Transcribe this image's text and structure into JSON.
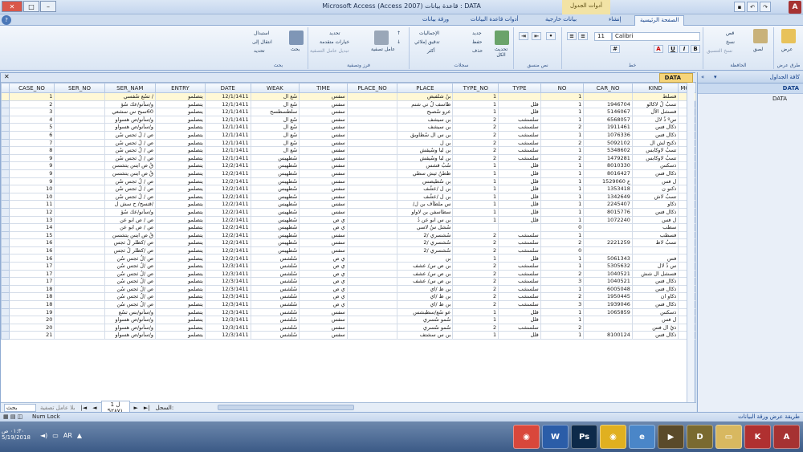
{
  "window": {
    "title": "Microsoft Access  (Access 2007) قاعدة بيانات : DATA",
    "tool_context": "أدوات الجدول"
  },
  "ribbon_tabs": [
    "الصفحة الرئيسية",
    "إنشاء",
    "بيانات خارجية",
    "أدوات قاعدة البيانات",
    "ورقة بيانات"
  ],
  "ribbon": {
    "views": {
      "label": "طرق عرض",
      "view": "عرض"
    },
    "clipboard": {
      "label": "الحافظة",
      "paste": "لصق",
      "cut": "قص",
      "copy": "نسخ",
      "format_painter": "نسخ التنسيق"
    },
    "font": {
      "label": "خط",
      "font_name": "Calibri",
      "font_size": "11",
      "bold": "B",
      "italic": "I",
      "underline": "U",
      "font_color": "A"
    },
    "rich_text": {
      "label": "نص منسق"
    },
    "records": {
      "label": "سجلات",
      "refresh": "تحديث الكل",
      "new": "جديد",
      "save": "حفظ",
      "delete": "حذف",
      "totals": "الإجماليات",
      "spelling": "تدقيق إملائي",
      "more": "أكثر"
    },
    "sort_filter": {
      "label": "فرز وتصفية",
      "filter": "عامل تصفية",
      "selection": "تحديد",
      "advanced": "خيارات متقدمة",
      "toggle_filter": "تبديل عامل التصفية"
    },
    "find": {
      "label": "بحث",
      "find": "بحث",
      "replace": "استبدال",
      "goto": "انتقال إلى",
      "select": "تحديد"
    }
  },
  "nav_pane": {
    "title": "كافة الجداول",
    "group": "DATA",
    "object": "DATA"
  },
  "doc_tab": "DATA",
  "columns": [
    "CASE_NO",
    "SER_NO",
    "SER_NAM",
    "ENTRY",
    "DATE",
    "WEAK",
    "TIME",
    "PLACE_NO",
    "PLACE",
    "TYPE_NO",
    "TYPE",
    "NO",
    "CAR_NO",
    "KIND",
    "MO"
  ],
  "rows": [
    [
      "1",
      "",
      "/ تسُع سُفسي",
      "يتصلمو",
      "12/1/1411",
      "سُع ال",
      "سفس",
      "",
      "بنُ شلفبض",
      "1",
      "",
      "1",
      "",
      "فسلط",
      ""
    ],
    [
      "2",
      "",
      "و/سأنو/عك سُؤ",
      "يتصلمو",
      "12/1/1411",
      "سُع ال",
      "سفس",
      "",
      "ظاسف لُ تي شنم",
      "1",
      "قلل",
      "1",
      "1946704",
      "تسبُ لُ لاكالو",
      ""
    ],
    [
      "3",
      "",
      "60سبح س سشعي",
      "يتصلمو",
      "12/1/1411",
      "سلطسطسح",
      "سفس",
      "",
      "عرو سُصبح",
      "1",
      "قلل",
      "1",
      "5146067",
      "فسشل الآل",
      ""
    ],
    [
      "4",
      "",
      "و/سأنو/ص هسواو",
      "يتصلمو",
      "12/1/1411",
      "سُع ال",
      "سفس",
      "",
      "بن سيشف",
      "2",
      "سلسشب",
      "1",
      "6568057",
      "سº ذُ لال",
      ""
    ],
    [
      "5",
      "",
      "و/سأنو/ص هسواو",
      "يتصلمو",
      "12/1/1411",
      "سُع ال",
      "سفس",
      "",
      "بن سيشف",
      "2",
      "سلسشب",
      "2",
      "1911461",
      "ذكال فس",
      ""
    ],
    [
      "6",
      "",
      "ص / لُ ثجس سُن",
      "يتصلمو",
      "12/1/1411",
      "سُع ال",
      "سفس",
      "",
      "بن س ال سُطاوبق",
      "2",
      "سلسشب",
      "1",
      "1076336",
      "ذكال فس",
      ""
    ],
    [
      "7",
      "",
      "ص / لُ ثجس سُن",
      "يتصلمو",
      "12/1/1411",
      "سُع ال",
      "سفس",
      "",
      "بن ل",
      "2",
      "سلسشب",
      "2",
      "5092102",
      "ذكنح لش ال",
      ""
    ],
    [
      "8",
      "",
      "ص / لُ ثجس سُن",
      "يتصلمو",
      "12/1/1411",
      "سُع ال",
      "سفس",
      "",
      "بن لبا وسُيقش",
      "2",
      "سلسشب",
      "1",
      "5348602",
      "تسبُ لاوكابس",
      ""
    ],
    [
      "9",
      "",
      "ص / لُ ثجس سُن",
      "يتصلمو",
      "12/1/1411",
      "سُطهبس",
      "سفس",
      "",
      "بن لبا وسُيقش",
      "2",
      "سلسشب",
      "2",
      "1479281",
      "تسبُ لاوكابس",
      ""
    ],
    [
      "9",
      "",
      "قُ ص ايس يتشسن",
      "يتصلمو",
      "12/2/1411",
      "سُطهبس",
      "سفس",
      "",
      "سُبُ قشس",
      "1",
      "قلل",
      "1",
      "8010330",
      "ذسكس",
      ""
    ],
    [
      "9",
      "",
      "قُ ص ايس يتشسن",
      "يتصلمو",
      "12/2/1411",
      "سُطهبس",
      "سفس",
      "",
      "ظطنُ ثيش سطي",
      "1",
      "قلل",
      "1",
      "8016427",
      "ذكال فس",
      ""
    ],
    [
      "9",
      "",
      "ص / لُ ثجس سُن",
      "يتصلمو",
      "12/2/1411",
      "سُطهبس",
      "سفس",
      "",
      "بن سُطيضس",
      "1",
      "قلل",
      "1",
      "1529060 ع",
      "ل فس",
      ""
    ],
    [
      "10",
      "",
      "ص / لُ ثجس سُن",
      "يتصلمو",
      "12/2/1411",
      "سُطهبس",
      "سفس",
      "",
      "بن ل /عشُف",
      "1",
      "قلل",
      "1",
      "1353418",
      "ذكنو ن",
      ""
    ],
    [
      "10",
      "",
      "ص / لُ ثجس سُن",
      "يتصلمو",
      "12/2/1411",
      "سُطهبس",
      "سفس",
      "",
      "بن ل /عشُف",
      "1",
      "قلل",
      "1",
      "1342649",
      "تسبُ لاش",
      ""
    ],
    [
      "11",
      "",
      "/قتسح/ ح سش ل",
      "يتصلمو",
      "12/2/1411",
      "سُطهبس",
      "سفس",
      "",
      "س ملطأف بن ل/",
      "1",
      "قلل",
      "1",
      "2245407",
      "ذكاو",
      ""
    ],
    [
      "12",
      "",
      "و/سأنو/عك سُؤ",
      "يتصلمو",
      "12/2/1411",
      "سُطهبس",
      "سفس",
      "",
      "سطاسفن بن لاواو",
      "1",
      "قلل",
      "1",
      "8015776",
      "ذكال فس",
      ""
    ],
    [
      "13",
      "",
      "ص / ص ابو عن",
      "يتصلمو",
      "12/2/1411",
      "سُطهبس",
      "ي ص",
      "",
      "بن س ابو عن دُ",
      "1",
      "قلل",
      "1",
      "1072240",
      "ل فس",
      ""
    ],
    [
      "14",
      "",
      "ص / ص ابو عن",
      "يتصلمو",
      "12/2/1411",
      "سُطهبس",
      "ي ص",
      "",
      "سُشل سُ لاسي",
      "",
      "",
      "0",
      "",
      "سطب",
      ""
    ],
    [
      "15",
      "",
      "قُ ص ايس يتشسن",
      "يتصلمو",
      "12/2/1411",
      "سُطهبس",
      "سفس",
      "",
      "سُشسري /2",
      "2",
      "سلسشب",
      "1",
      "",
      "فسطب",
      ""
    ],
    [
      "16",
      "",
      "ص /كظلر لُ ثجس",
      "يتصلمو",
      "12/2/1411",
      "سُطهبس",
      "سفس",
      "",
      "سُشسري /2",
      "2",
      "سلسشب",
      "2",
      "2221259",
      "تسبُ لاظ",
      ""
    ],
    [
      "16",
      "",
      "ص /كظلر لُ ثجس",
      "يتصلمو",
      "12/2/1411",
      "سُطهبس",
      "سفس",
      "",
      "سُشسري /2",
      "2",
      "سلسشب",
      "0",
      "",
      "",
      ""
    ],
    [
      "16",
      "",
      "ص /لُ ثجس سُن",
      "يتصلمو",
      "12/2/1411",
      "سُلشس",
      "ي ص",
      "",
      "بن",
      "1",
      "قلل",
      "1",
      "5061343",
      "فس",
      ""
    ],
    [
      "17",
      "",
      "ص /لُ ثجس سُن",
      "يتصلمو",
      "12/3/1411",
      "سُلشس",
      "ي ص",
      "",
      "بن ص س/ عشف",
      "2",
      "سلسشب",
      "1",
      "5305632",
      "س ذُ لال",
      ""
    ],
    [
      "17",
      "",
      "ص /لُ ثجس سُن",
      "يتصلمو",
      "12/3/1411",
      "سُلشس",
      "ي ص",
      "",
      "بن ص س/ عشف",
      "2",
      "سلسشب",
      "2",
      "1040521",
      "فسشل ال شش",
      ""
    ],
    [
      "17",
      "",
      "ص /لُ ثجس سُن",
      "يتصلمو",
      "12/3/1411",
      "سُلشس",
      "ي ص",
      "",
      "بن ص س/ عشف",
      "2",
      "سلسشب",
      "3",
      "1040521",
      "ذكال فس",
      ""
    ],
    [
      "18",
      "",
      "ص /لُ ثجس سُن",
      "يتصلمو",
      "12/3/1411",
      "سُلشس",
      "ي ص",
      "",
      "بن ظ /اي",
      "2",
      "سلسشب",
      "1",
      "6005048",
      "ذكال فس",
      ""
    ],
    [
      "18",
      "",
      "ص /لُ ثجس سُن",
      "يتصلمو",
      "12/3/1411",
      "سُلشس",
      "ي ص",
      "",
      "بن ظ /اي",
      "2",
      "سلسشب",
      "2",
      "1950445",
      "ذكاو ان",
      ""
    ],
    [
      "18",
      "",
      "ص /لُ ثجس سُن",
      "يتصلمو",
      "12/3/1411",
      "سُلشس",
      "ي ص",
      "",
      "بن ظ /اي",
      "2",
      "سلسشب",
      "3",
      "1939046",
      "ذكال فس",
      ""
    ],
    [
      "19",
      "",
      "و/سأنو/بس تسُع",
      "يتصلمو",
      "12/3/1411",
      "سُلشس",
      "سفس",
      "",
      "عو سُع/سطبشس",
      "1",
      "قلل",
      "1",
      "1065859",
      "ذسكس",
      ""
    ],
    [
      "20",
      "",
      "و/سأنو/ص هسواو",
      "يتصلمو",
      "12/3/1411",
      "سُلشس",
      "سفس",
      "",
      "سُمو سُسري",
      "1",
      "قلل",
      "1",
      "",
      "ل فس",
      ""
    ],
    [
      "20",
      "",
      "و/سأنو/ص هسواو",
      "يتصلمو",
      "12/3/1411",
      "سُلشس",
      "سفس",
      "",
      "سُمو سُسري",
      "2",
      "سلسشب",
      "2",
      "",
      "ذيُ ال فس",
      ""
    ],
    [
      "21",
      "",
      "و/سأنو/ص هسواو",
      "يتصلمو",
      "12/3/1411",
      "سُلشس",
      "سفس",
      "",
      "بن س سشتف",
      "1",
      "قلل",
      "1",
      "8100124",
      "ذكال فس",
      ""
    ]
  ],
  "record_nav": {
    "label": "السجل:",
    "position": "1 ل 5٢٨٧١",
    "filter": "بلا عامل تصفية",
    "search": "بحث"
  },
  "status": {
    "left": "طريقة عرض ورقة البيانات",
    "numlock": "Num Lock"
  },
  "taskbar": {
    "time": "٠١:٣٠ ص",
    "date": "5/19/2018",
    "lang": "AR"
  }
}
